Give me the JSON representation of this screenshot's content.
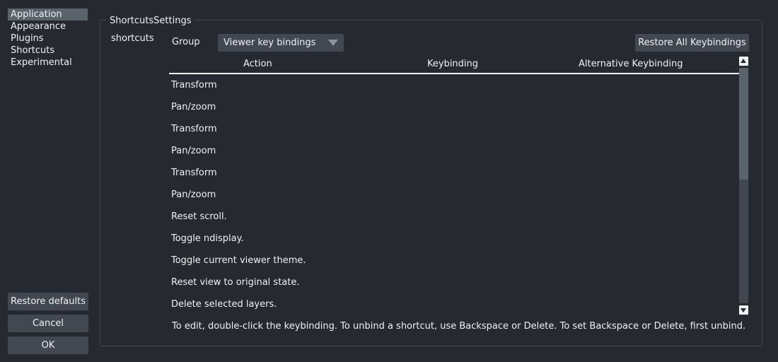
{
  "sidebar": {
    "items": [
      {
        "label": "Application",
        "selected": true
      },
      {
        "label": "Appearance",
        "selected": false
      },
      {
        "label": "Plugins",
        "selected": false
      },
      {
        "label": "Shortcuts",
        "selected": false
      },
      {
        "label": "Experimental",
        "selected": false
      }
    ]
  },
  "buttons": {
    "restore_defaults": "Restore defaults",
    "cancel": "Cancel",
    "ok": "OK"
  },
  "panel": {
    "title": "ShortcutsSettings",
    "field_label": "shortcuts",
    "group_label": "Group",
    "group_selected": "Viewer key bindings",
    "restore_all": "Restore All Keybindings",
    "hint": "To edit, double-click the keybinding. To unbind a shortcut, use Backspace or Delete. To set Backspace or Delete, first unbind."
  },
  "table": {
    "columns": [
      "Action",
      "Keybinding",
      "Alternative Keybinding"
    ],
    "rows": [
      {
        "action": "Transform",
        "keybinding": "",
        "alternative": ""
      },
      {
        "action": "Pan/zoom",
        "keybinding": "",
        "alternative": ""
      },
      {
        "action": "Transform",
        "keybinding": "",
        "alternative": ""
      },
      {
        "action": "Pan/zoom",
        "keybinding": "",
        "alternative": ""
      },
      {
        "action": "Transform",
        "keybinding": "",
        "alternative": ""
      },
      {
        "action": "Pan/zoom",
        "keybinding": "",
        "alternative": ""
      },
      {
        "action": "Reset scroll.",
        "keybinding": "",
        "alternative": ""
      },
      {
        "action": "Toggle ndisplay.",
        "keybinding": "",
        "alternative": ""
      },
      {
        "action": "Toggle current viewer theme.",
        "keybinding": "",
        "alternative": ""
      },
      {
        "action": "Reset view to original state.",
        "keybinding": "",
        "alternative": ""
      },
      {
        "action": "Delete selected layers.",
        "keybinding": "",
        "alternative": ""
      }
    ]
  },
  "colors": {
    "background": "#262930",
    "foreground": "#414851",
    "primary": "#5a626c",
    "text": "#f0f1f2"
  },
  "icons": {
    "dropdown": "chevron-down-icon",
    "scroll_up": "arrow-up-icon",
    "scroll_down": "arrow-down-icon"
  }
}
